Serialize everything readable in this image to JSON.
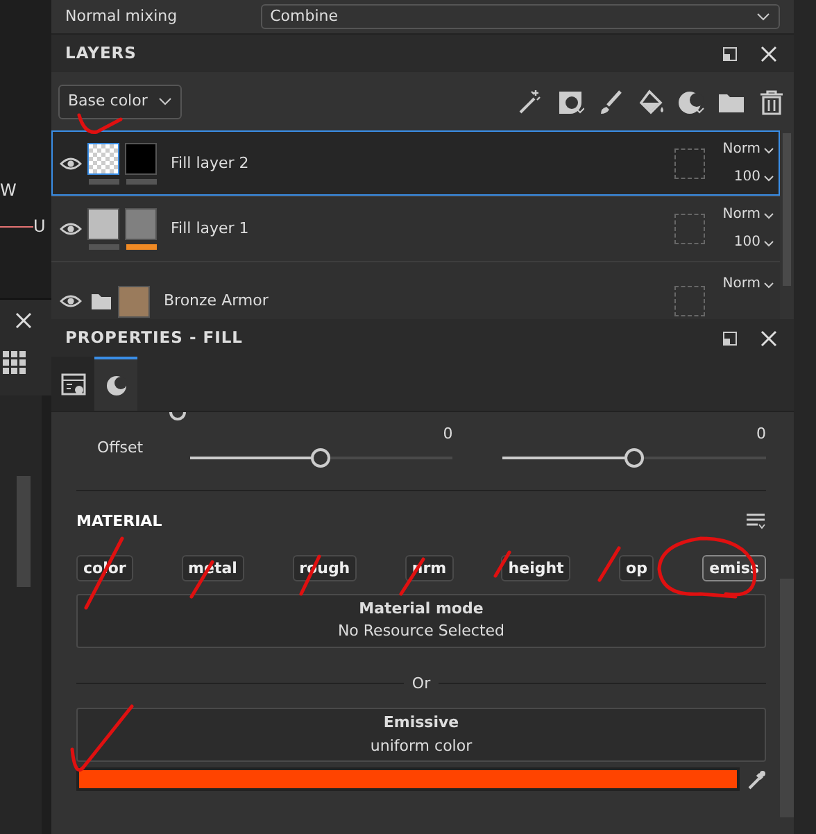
{
  "top_setting": {
    "label": "Normal mixing",
    "value": "Combine"
  },
  "left_panel": {
    "axis_labels": [
      "W",
      "U"
    ]
  },
  "layers_panel": {
    "title": "LAYERS",
    "channel_dropdown": "Base color",
    "layers": [
      {
        "name": "Fill layer 2",
        "kind": "fill",
        "selected": true,
        "thumbnails": [
          {
            "kind": "checker",
            "bar": {
              "color": "#555555"
            }
          },
          {
            "kind": "swatch",
            "color": "#000000",
            "bar": {
              "color": "#555555"
            }
          }
        ],
        "blend": "Norm",
        "opacity": "100"
      },
      {
        "name": "Fill layer 1",
        "kind": "fill",
        "selected": false,
        "thumbnails": [
          {
            "kind": "swatch",
            "color": "#bdbdbd",
            "bar": {
              "color": "#555555"
            }
          },
          {
            "kind": "swatch",
            "color": "#808080",
            "bar": {
              "color": "#f08a24"
            }
          }
        ],
        "blend": "Norm",
        "opacity": "100"
      },
      {
        "name": "Bronze Armor",
        "kind": "folder",
        "selected": false,
        "thumbnails": [
          {
            "kind": "swatch",
            "color": "#9a7b5c"
          }
        ],
        "blend": "Norm"
      }
    ]
  },
  "properties_panel": {
    "title": "PROPERTIES - FILL",
    "tabs": [
      {
        "kind": "settings",
        "selected": false
      },
      {
        "kind": "material",
        "selected": true
      }
    ],
    "offset": {
      "label": "Offset",
      "sliders": [
        {
          "reading": "0",
          "level": 0.5
        },
        {
          "reading": "0",
          "level": 0.5
        }
      ]
    },
    "material": {
      "title": "MATERIAL",
      "channels": [
        {
          "label": "color",
          "selected": false
        },
        {
          "label": "metal",
          "selected": false
        },
        {
          "label": "rough",
          "selected": false
        },
        {
          "label": "nrm",
          "selected": false
        },
        {
          "label": "height",
          "selected": false
        },
        {
          "label": "op",
          "selected": false
        },
        {
          "label": "emiss",
          "selected": true
        }
      ],
      "material_mode": {
        "title": "Material mode",
        "value": "No Resource Selected"
      },
      "separator": "Or",
      "emissive": {
        "title": "Emissive",
        "value": "uniform color",
        "color": "#ff4400"
      }
    }
  }
}
